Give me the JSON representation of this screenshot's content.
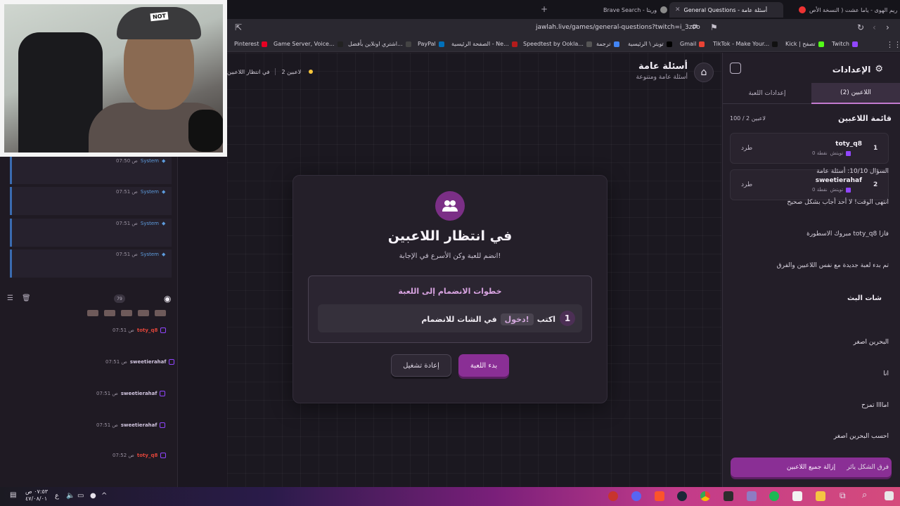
{
  "browser": {
    "tabs": [
      {
        "label": "ريم الهوى - ياما عشت ( النسخة الأص",
        "active": false
      },
      {
        "label": "General Questions - أسئلة عامة",
        "active": true
      },
      {
        "label": "Brave Search - وريتا",
        "active": false
      }
    ],
    "url": "jawlah.live/games/general-questions?twitch=i_3z0o",
    "bookmarks": [
      "Twitch",
      "Kick | تصفح",
      "TikTok - Make Your...",
      "Gmail",
      "تويتر \\ الرئيسية",
      "ترجمة",
      "Speedtest by Ookla...",
      "الصفحة الرئيسية - Ne...",
      "PayPal",
      "اشتري اونلاين بأفضل...",
      "Game Server, Voice...",
      "Pinterest"
    ]
  },
  "header": {
    "title": "أسئلة عامة",
    "subtitle": "أسئلة عامة ومتنوعة",
    "status_waiting": "في انتظار اللاعبين",
    "status_players": "2 لاعبين"
  },
  "card": {
    "title": "في انتظار اللاعبين",
    "subtitle": "انضم للعبة وكن الأسرع في الإجابة!",
    "steps_title": "خطوات الانضمام إلى اللعبة",
    "step_number": "1",
    "step_prefix": "اكتب",
    "step_code": "!دخول",
    "step_suffix": "في الشات للانضمام",
    "start_button": "بدء اللعبة",
    "restart_button": "إعادة تشغيل"
  },
  "sidebar": {
    "title": "الإعدادات",
    "tab_players": "اللاعبين (2)",
    "tab_settings": "إعدادات اللعبة",
    "list_title": "قائمة اللاعبين",
    "list_count": "100 / 2 لاعبين",
    "players": [
      {
        "rank": "1",
        "name": "toty_q8",
        "platform": "تويتش",
        "points": "0 نقطة",
        "kick": "طرد"
      },
      {
        "rank": "2",
        "name": "sweetierahaf",
        "platform": "تويتش",
        "points": "0 نقطة",
        "kick": "طرد"
      }
    ],
    "remove_all": "إزالة جميع اللاعبين"
  },
  "chat": {
    "system_messages": [
      {
        "author": "System",
        "time": "07:50 ص",
        "text": "السؤال 10/10: أسئلة عامة"
      },
      {
        "author": "System",
        "time": "07:51 ص",
        "text": "انتهى الوقت! لا أحد أجاب بشكل صحيح"
      },
      {
        "author": "System",
        "time": "07:51 ص",
        "text": "مبروك الاسطورة toty_q8 فازا"
      },
      {
        "author": "System",
        "time": "07:51 ص",
        "text": "تم بدء لعبة جديدة مع نفس اللاعبين والفرق"
      }
    ],
    "title": "شات البث",
    "count": "79",
    "messages": [
      {
        "author": "toty_q8",
        "time": "07:51 ص",
        "text": "البحرين اصغر",
        "color": "#e0453a"
      },
      {
        "author": "sweetierahaf",
        "time": "07:51 ص",
        "text": "انا",
        "color": "#d0c4de"
      },
      {
        "author": "sweetierahaf",
        "time": "07:51 ص",
        "text": "اماااا تمزح",
        "color": "#d0c4de"
      },
      {
        "author": "sweetierahaf",
        "time": "07:51 ص",
        "text": "احسب البحرين اصغر",
        "color": "#d0c4de"
      },
      {
        "author": "toty_q8",
        "time": "07:52 ص",
        "text": "فرق الشكل يائر",
        "color": "#e0453a"
      }
    ]
  },
  "webcam": {
    "cap_text": "NOT"
  },
  "taskbar": {
    "time": "٠٧:٥٣ ص",
    "date": "٤٧/٠٨/٠١",
    "lang": "ع"
  }
}
